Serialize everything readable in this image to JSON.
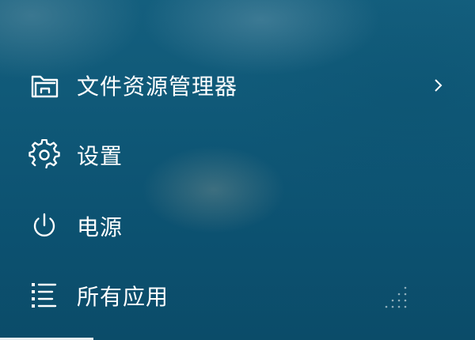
{
  "start_menu": {
    "items": [
      {
        "label": "文件资源管理器",
        "icon": "file-explorer-icon",
        "has_submenu": true
      },
      {
        "label": "设置",
        "icon": "settings-gear-icon",
        "has_submenu": false
      },
      {
        "label": "电源",
        "icon": "power-icon",
        "has_submenu": false
      },
      {
        "label": "所有应用",
        "icon": "all-apps-list-icon",
        "has_submenu": false
      }
    ]
  },
  "theme": {
    "background": "#0f5877",
    "foreground": "#ffffff"
  }
}
